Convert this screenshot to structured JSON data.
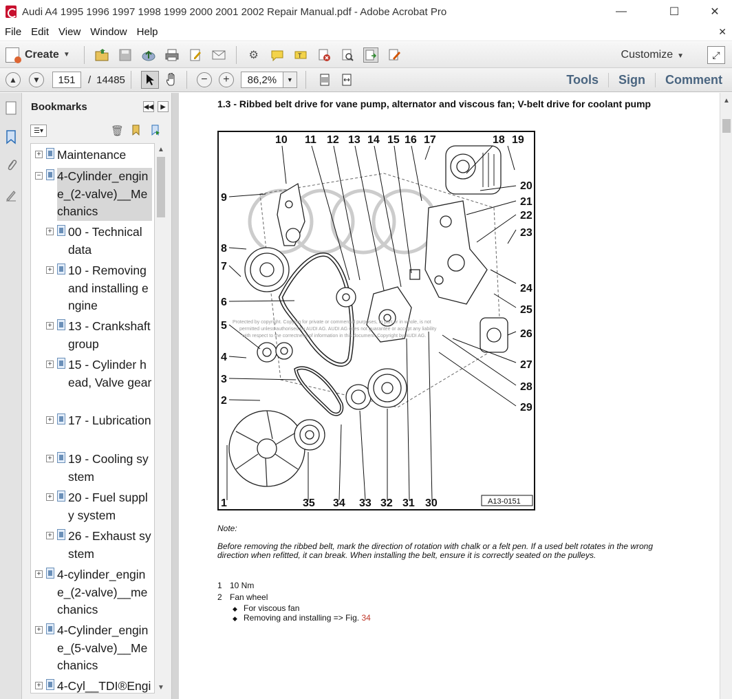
{
  "window": {
    "title": "Audi A4 1995 1996 1997 1998 1999 2000 2001 2002 Repair Manual.pdf - Adobe Acrobat Pro",
    "minimize": "—",
    "maximize": "☐",
    "close": "✕"
  },
  "menu": {
    "items": [
      "File",
      "Edit",
      "View",
      "Window",
      "Help"
    ],
    "close_doc": "✕"
  },
  "toolbar": {
    "create_label": "Create",
    "customize_label": "Customize"
  },
  "nav": {
    "current_page": "151",
    "page_separator": "/",
    "total_pages": "14485",
    "zoom": "86,2%",
    "tools_label": "Tools",
    "sign_label": "Sign",
    "comment_label": "Comment"
  },
  "bookmarks": {
    "title": "Bookmarks",
    "items": [
      {
        "label": "Maintenance",
        "level": 0
      },
      {
        "label": "4-Cylinder_engine_(2-valve)__Mechanics",
        "level": 0
      },
      {
        "label": "00 - Technical data",
        "level": 1
      },
      {
        "label": "10 - Removing and installing engine",
        "level": 1
      },
      {
        "label": "13 - Crankshaft group",
        "level": 1
      },
      {
        "label": "15 - Cylinder head, Valve gear",
        "level": 1
      },
      {
        "label": "17 - Lubrication",
        "level": 1
      },
      {
        "label": "19 - Cooling system",
        "level": 1
      },
      {
        "label": "20 - Fuel supply system",
        "level": 1
      },
      {
        "label": "26 - Exhaust system",
        "level": 1
      },
      {
        "label": "4-cylinder_engine_(2-valve)__mechanics",
        "level": 0
      },
      {
        "label": "4-Cylinder_engine_(5-valve)__Mechanics",
        "level": 0
      },
      {
        "label": "4-Cyl__TDI®Engi",
        "level": 0
      }
    ]
  },
  "document": {
    "heading": "1.3 - Ribbed belt drive for vane pump, alternator and viscous fan; V-belt drive for coolant pump",
    "figure": {
      "id": "A13-0151",
      "top_numbers": [
        "10",
        "11",
        "12",
        "13",
        "14",
        "15",
        "16",
        "17",
        "18",
        "19"
      ],
      "right_numbers": [
        "20",
        "21",
        "22",
        "23",
        "24",
        "25",
        "26",
        "27",
        "28",
        "29"
      ],
      "left_numbers": [
        "9",
        "8",
        "7",
        "6",
        "5",
        "4",
        "3",
        "2",
        "1"
      ],
      "bottom_numbers": [
        "35",
        "34",
        "33",
        "32",
        "31",
        "30"
      ],
      "watermark_line1": "Protected by copyright. Copying for private or commercial purposes, in part or in whole, is not",
      "watermark_line2": "permitted unless authorised by AUDI AG. AUDI AG does not guarantee or accept any liability",
      "watermark_line3": "with respect to the correctness of information in this document. Copyright by AUDI AG."
    },
    "note_title": "Note:",
    "note_body": "Before removing the ribbed belt, mark the direction of rotation with chalk or a felt pen. If a used belt rotates in the wrong direction when refitted, it can break. When installing the belt, ensure it is correctly seated on the pulleys.",
    "legend": [
      {
        "num": "1",
        "text": "10 Nm"
      },
      {
        "num": "2",
        "text": "Fan wheel"
      }
    ],
    "bullets": [
      {
        "text": "For viscous fan",
        "link": ""
      },
      {
        "text": "Removing and installing => Fig.",
        "link": "34"
      }
    ]
  }
}
